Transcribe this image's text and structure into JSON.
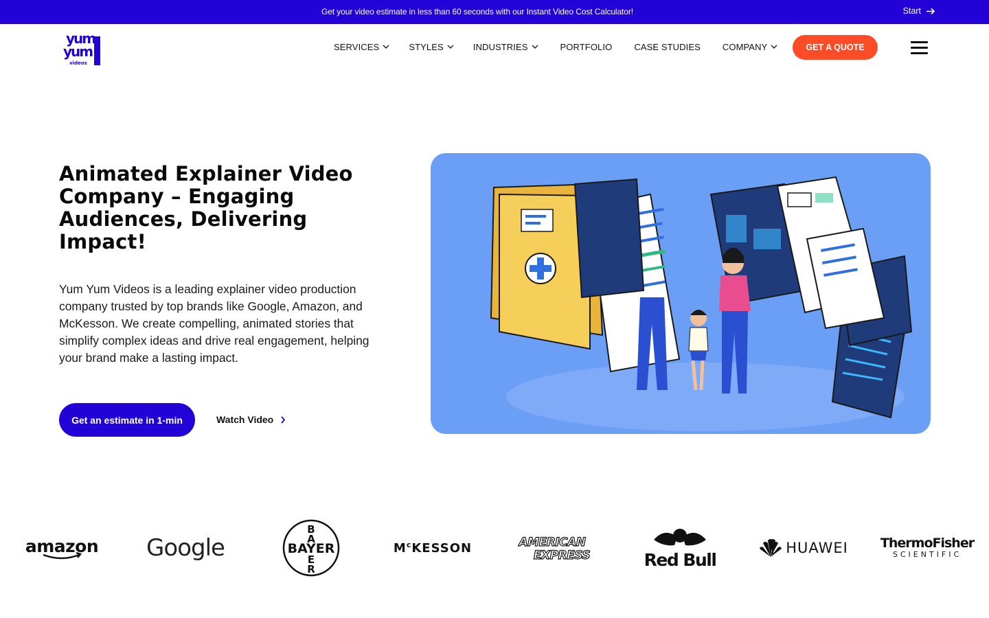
{
  "announcement": {
    "message": "Get your video estimate in less than 60 seconds with our Instant Video Cost Calculator!",
    "start_label": "Start"
  },
  "brand": {
    "logo_text_top": "yum",
    "logo_text_mid": "yum",
    "logo_text_bottom": "videos",
    "primary_color": "#2302d8",
    "accent_color": "#fb4b27"
  },
  "nav": {
    "items": [
      {
        "label": "SERVICES",
        "has_dropdown": true
      },
      {
        "label": "STYLES",
        "has_dropdown": true
      },
      {
        "label": "INDUSTRIES",
        "has_dropdown": true
      },
      {
        "label": "PORTFOLIO",
        "has_dropdown": false
      },
      {
        "label": "CASE STUDIES",
        "has_dropdown": false
      },
      {
        "label": "COMPANY",
        "has_dropdown": true
      }
    ],
    "quote_label": "GET A QUOTE",
    "menu_icon": "hamburger-icon"
  },
  "hero": {
    "title": "Animated Explainer Video Company – Engaging Audiences, Delivering Impact!",
    "description": "Yum Yum Videos is a leading explainer video production company trusted by top brands like Google, Amazon, and McKesson. We create compelling, animated stories that simplify complex ideas and drive real engagement, helping your brand make a lasting impact.",
    "primary_cta": "Get an estimate in 1-min",
    "secondary_cta": "Watch Video",
    "media_background": "#6b9ff6"
  },
  "client_logos": [
    {
      "name": "amazon"
    },
    {
      "name": "Google"
    },
    {
      "name": "BAYER",
      "vertical": "BAYER"
    },
    {
      "name": "MCKESSON",
      "prefix": "M",
      "superscript": "c",
      "rest": "KESSON"
    },
    {
      "name": "AMERICAN EXPRESS",
      "line1": "AMERICAN",
      "line2": "EXPRESS"
    },
    {
      "name": "Red Bull"
    },
    {
      "name": "HUAWEI"
    },
    {
      "name": "ThermoFisher",
      "line2": "SCIENTIFIC"
    }
  ]
}
